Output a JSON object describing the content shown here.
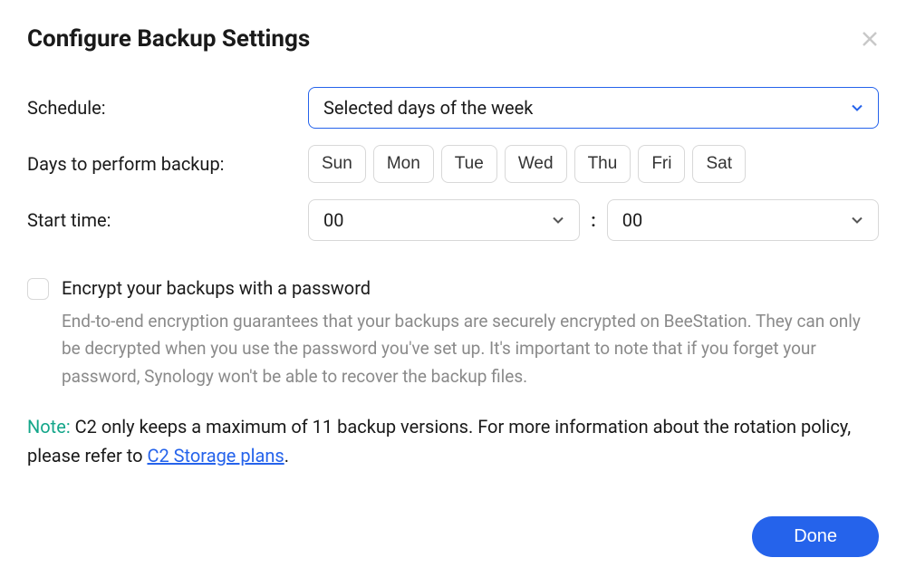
{
  "header": {
    "title": "Configure Backup Settings"
  },
  "schedule": {
    "label": "Schedule:",
    "value": "Selected days of the week"
  },
  "days": {
    "label": "Days to perform backup:",
    "options": [
      "Sun",
      "Mon",
      "Tue",
      "Wed",
      "Thu",
      "Fri",
      "Sat"
    ]
  },
  "start_time": {
    "label": "Start time:",
    "hour": "00",
    "minute": "00",
    "separator": ":"
  },
  "encrypt": {
    "label": "Encrypt your backups with a password",
    "description": "End-to-end encryption guarantees that your backups are securely encrypted on BeeStation. They can only be decrypted when you use the password you've set up. It's important to note that if you forget your password, Synology won't be able to recover the backup files."
  },
  "note": {
    "prefix": "Note:",
    "text_before": " C2 only keeps a maximum of 11 backup versions. For more information about the rotation policy, please refer to ",
    "link_text": "C2 Storage plans",
    "text_after": "."
  },
  "footer": {
    "done_label": "Done"
  }
}
